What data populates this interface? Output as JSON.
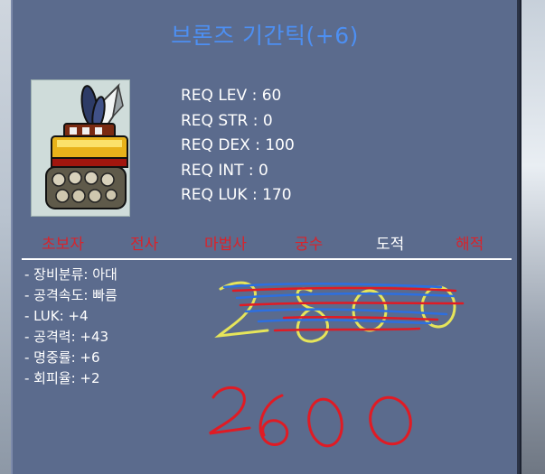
{
  "item": {
    "title": "브론즈 기간틱(+6)",
    "icon": "katara-claw-icon"
  },
  "requirements": [
    "REQ LEV : 60",
    "REQ STR : 0",
    "REQ DEX : 100",
    "REQ INT : 0",
    "REQ LUK : 170"
  ],
  "jobs": [
    {
      "label": "초보자",
      "color": "#d9232b"
    },
    {
      "label": "전사",
      "color": "#d9232b"
    },
    {
      "label": "마법사",
      "color": "#d9232b"
    },
    {
      "label": "궁수",
      "color": "#d9232b"
    },
    {
      "label": "도적",
      "color": "#ffffff"
    },
    {
      "label": "해적",
      "color": "#d9232b"
    }
  ],
  "stats": [
    "- 장비분류: 아대",
    "- 공격속도: 빠름",
    "- LUK: +4",
    "- 공격력: +43",
    "- 명중률: +6",
    "- 회피율: +2"
  ],
  "annotations": {
    "crossed_price_icon": "crossed-out-price-scribble",
    "new_price": "2600"
  },
  "colors": {
    "panel_bg": "#5b6b8d",
    "title": "#4d8ff2",
    "job_disabled": "#d9232b",
    "job_enabled": "#ffffff",
    "scribble_red": "#e01b24",
    "scribble_blue": "#2d6fe0",
    "scribble_yellow": "#e6e55a"
  }
}
